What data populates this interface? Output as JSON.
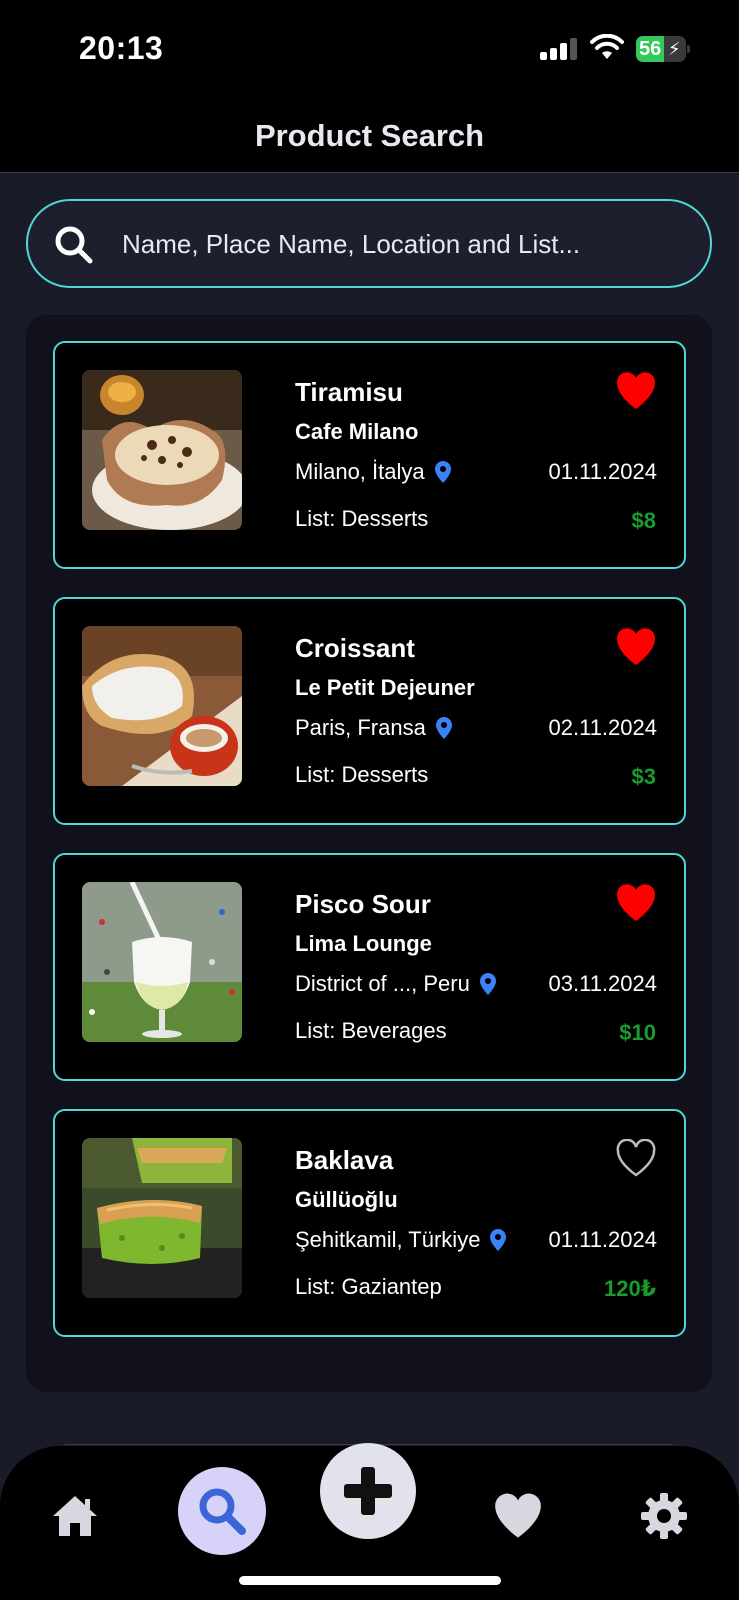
{
  "status_bar": {
    "time": "20:13",
    "battery_percent": "56",
    "battery_level": 0.56,
    "signal_bars": 3,
    "battery_color": "#34c759"
  },
  "header": {
    "title": "Product Search"
  },
  "search": {
    "placeholder": "Name, Place Name, Location and List...",
    "value": "",
    "icon": "search-icon",
    "border_color": "#4fd8d8"
  },
  "products": [
    {
      "name": "Tiramisu",
      "place": "Cafe Milano",
      "location": "Milano, İtalya",
      "date": "01.11.2024",
      "list": "List: Desserts",
      "price": "$8",
      "favorite": true
    },
    {
      "name": "Croissant",
      "place": "Le Petit Dejeuner",
      "location": "Paris, Fransa",
      "date": "02.11.2024",
      "list": "List: Desserts",
      "price": "$3",
      "favorite": true
    },
    {
      "name": "Pisco Sour",
      "place": "Lima Lounge",
      "location": "District of ..., Peru",
      "date": "03.11.2024",
      "list": "List: Beverages",
      "price": "$10",
      "favorite": true
    },
    {
      "name": "Baklava",
      "place": "Güllüoğlu",
      "location": "Şehitkamil, Türkiye",
      "date": "01.11.2024",
      "list": "List: Gaziantep",
      "price": "120₺",
      "favorite": false
    }
  ],
  "colors": {
    "accent": "#4fd8d8",
    "price": "#1a9c2c",
    "heart_active": "#ff0000",
    "pin": "#3b82f6",
    "active_tab_bg": "#d7d2f7",
    "active_tab_icon": "#3a66d8"
  },
  "bottom_nav": {
    "items": [
      "home-icon",
      "search-icon",
      "plus-icon",
      "heart-icon",
      "gear-icon"
    ],
    "active": "search-icon"
  }
}
